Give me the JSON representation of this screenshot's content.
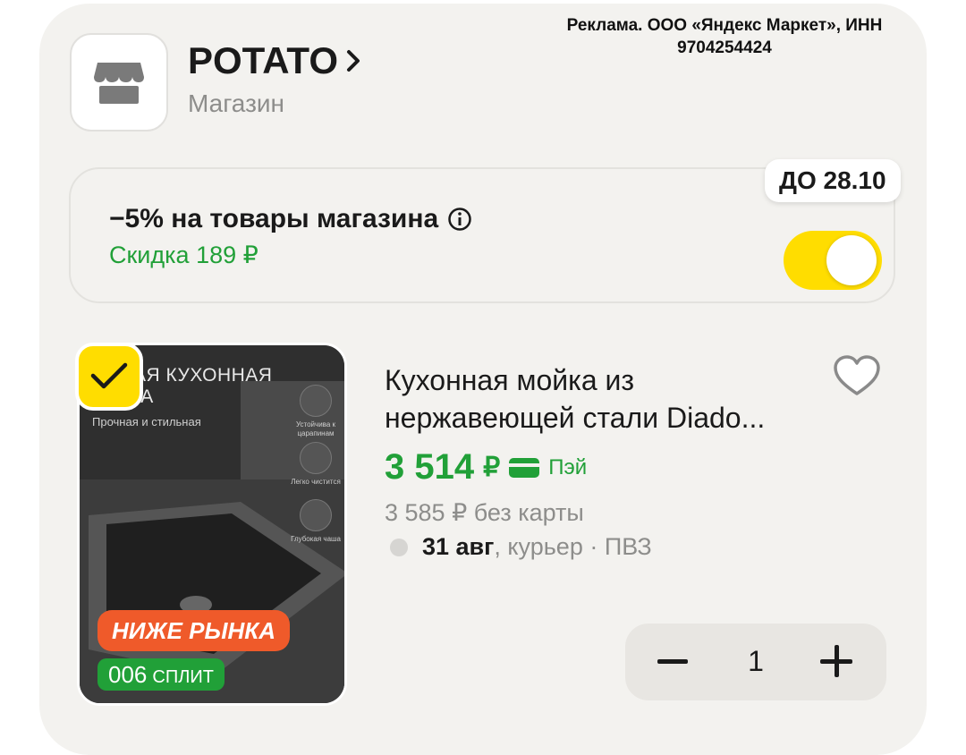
{
  "ad_notice": "Реклама. ООО «Яндекс Маркет», ИНН 9704254424",
  "shop": {
    "name": "POTATO",
    "subtitle": "Магазин",
    "icon": "store-icon"
  },
  "promo": {
    "title": "−5% на товары магазина",
    "discount": "Скидка 189 ₽",
    "badge": "ДО 28.10",
    "toggle_on": true
  },
  "product": {
    "image_title_line1": "АЯ КУХОННАЯ",
    "image_title_line2": "КА",
    "image_subtitle": "Прочная и стильная",
    "image_features": [
      "Устойчива к царапинам",
      "Легко чистится",
      "Глубокая чаша"
    ],
    "tag_market": "НИЖЕ РЫНКА",
    "tag_split_num": "006",
    "tag_split_label": "СПЛИТ",
    "title": "Кухонная мойка из нержавеющей стали Diado...",
    "price": "3 514",
    "currency": "₽",
    "pay_label": "Пэй",
    "old_price": "3 585 ₽ без карты",
    "delivery_date": "31 авг",
    "delivery_method": ", курьер · ПВЗ",
    "quantity": "1",
    "selected": true
  },
  "colors": {
    "accent_yellow": "#ffdd00",
    "green": "#21a038",
    "tag_red": "#ef5a2a"
  }
}
